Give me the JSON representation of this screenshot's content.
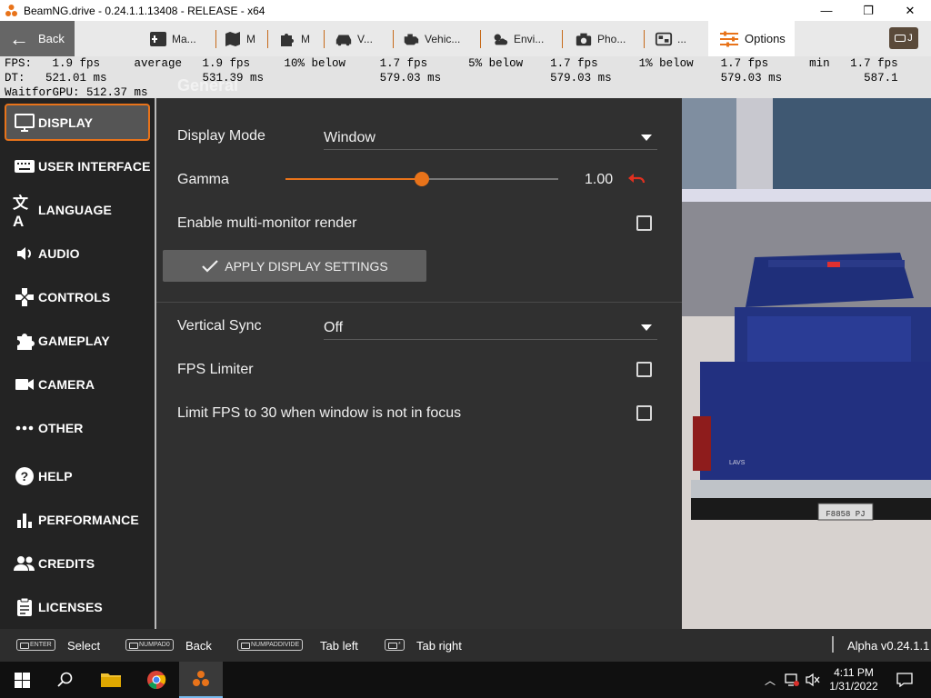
{
  "window": {
    "title": "BeamNG.drive - 0.24.1.1.13408 - RELEASE - x64",
    "min": "—",
    "max": "❐",
    "close": "✕"
  },
  "topbar": {
    "back_label": "Back",
    "tabs": [
      {
        "label": "Ma...",
        "icon": "map-pin-icon"
      },
      {
        "label": "M",
        "icon": "map-icon"
      },
      {
        "label": "M",
        "icon": "puzzle-icon"
      },
      {
        "label": "V...",
        "icon": "car-icon"
      },
      {
        "label": "Vehic...",
        "icon": "engine-icon"
      },
      {
        "label": "Envi...",
        "icon": "weather-icon"
      },
      {
        "label": "Pho...",
        "icon": "camera-icon"
      },
      {
        "label": "...",
        "icon": "photo-gallery-icon"
      }
    ],
    "active_tab": "Options",
    "right_button": "J"
  },
  "stats": {
    "line1": "FPS:   1.9 fps     average   1.9 fps     10% below     1.7 fps      5% below    1.7 fps      1% below    1.7 fps      min   1.7 fps",
    "line2": "DT:   521.01 ms              531.39 ms                 579.03 ms                579.03 ms                579.03 ms            587.1",
    "line3": "WaitforGPU: 512.37 ms"
  },
  "panel": {
    "section_title": "General",
    "display_mode_label": "Display Mode",
    "display_mode_value": "Window",
    "gamma_label": "Gamma",
    "gamma_value": "1.00",
    "gamma_fraction": 0.5,
    "multi_monitor_label": "Enable multi-monitor render",
    "apply_label": "APPLY DISPLAY SETTINGS",
    "vsync_label": "Vertical Sync",
    "vsync_value": "Off",
    "fps_limiter_label": "FPS Limiter",
    "limit_fps_label": "Limit FPS to 30 when window is not in focus"
  },
  "sidebar": {
    "items": [
      {
        "label": "DISPLAY",
        "icon": "monitor-icon",
        "active": true
      },
      {
        "label": "USER INTERFACE",
        "icon": "keyboard-icon"
      },
      {
        "label": "LANGUAGE",
        "icon": "translate-icon"
      },
      {
        "label": "AUDIO",
        "icon": "speaker-icon"
      },
      {
        "label": "CONTROLS",
        "icon": "gamepad-icon"
      },
      {
        "label": "GAMEPLAY",
        "icon": "puzzle-icon"
      },
      {
        "label": "CAMERA",
        "icon": "video-camera-icon"
      },
      {
        "label": "OTHER",
        "icon": "more-icon"
      },
      {
        "label": "HELP",
        "icon": "help-icon"
      },
      {
        "label": "PERFORMANCE",
        "icon": "bar-chart-icon"
      },
      {
        "label": "CREDITS",
        "icon": "people-icon"
      },
      {
        "label": "LICENSES",
        "icon": "license-icon"
      }
    ]
  },
  "bottombar": {
    "hints": [
      {
        "key": "ENTER",
        "label": "Select"
      },
      {
        "key": "NUMPAD0",
        "label": "Back"
      },
      {
        "key": "NUMPADDIVIDE",
        "label": "Tab left"
      },
      {
        "key": "*",
        "label": "Tab right"
      }
    ],
    "version": "Alpha v0.24.1.1"
  },
  "scene": {
    "plate": "F8858 PJ",
    "badge": "LAVS"
  },
  "taskbar": {
    "time": "4:11 PM",
    "date": "1/31/2022"
  },
  "colors": {
    "accent": "#e8731a",
    "panel": "#303030",
    "sidebar": "#232323",
    "revert": "#e03020"
  }
}
